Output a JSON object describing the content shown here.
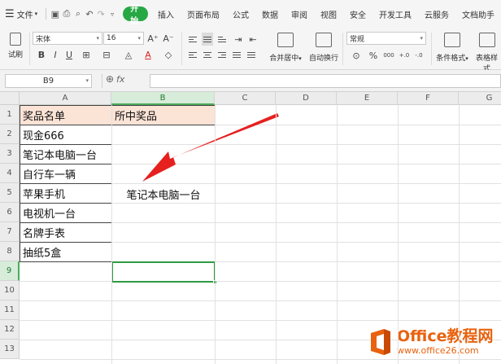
{
  "menubar": {
    "file_label": "文件",
    "start_label": "开始",
    "tabs": [
      "插入",
      "页面布局",
      "公式",
      "数据",
      "审阅",
      "视图",
      "安全",
      "开发工具",
      "云服务",
      "文档助手"
    ]
  },
  "ribbon": {
    "format_painter_label": "试刷",
    "font_name": "宋体",
    "font_size": "16",
    "grow_font": "A⁺",
    "shrink_font": "A⁻",
    "bold": "B",
    "italic": "I",
    "underline": "U",
    "merge_label": "合并居中",
    "wrap_label": "自动换行",
    "number_format": "常规",
    "percent": "%",
    "thousands": "000",
    "inc_decimal": "+.0",
    "dec_decimal": "-.0",
    "cond_format_label": "条件格式",
    "table_style_label": "表格样式"
  },
  "formula_bar": {
    "cell_ref": "B9",
    "fx_label": "fx",
    "value": ""
  },
  "grid": {
    "columns": [
      "A",
      "B",
      "C",
      "D",
      "E",
      "F",
      "G"
    ],
    "rows": [
      "1",
      "2",
      "3",
      "4",
      "5",
      "6",
      "7",
      "8",
      "9",
      "10",
      "11",
      "12",
      "13"
    ],
    "selected_column": "B",
    "selected_row": "9",
    "header_a": "奖品名单",
    "header_b": "所中奖品",
    "list_a": [
      "现金666",
      "笔记本电脑一台",
      "自行车一辆",
      "苹果手机",
      "电视机一台",
      "名牌手表",
      "抽纸5盒"
    ],
    "merged_b": "笔记本电脑一台"
  },
  "colors": {
    "accent": "#27a844",
    "header_fill": "#fbe3d6",
    "arrow": "#e5201f",
    "watermark": "#e8620f"
  },
  "watermark": {
    "brand": "Office教程网",
    "url": "www.office26.com"
  }
}
